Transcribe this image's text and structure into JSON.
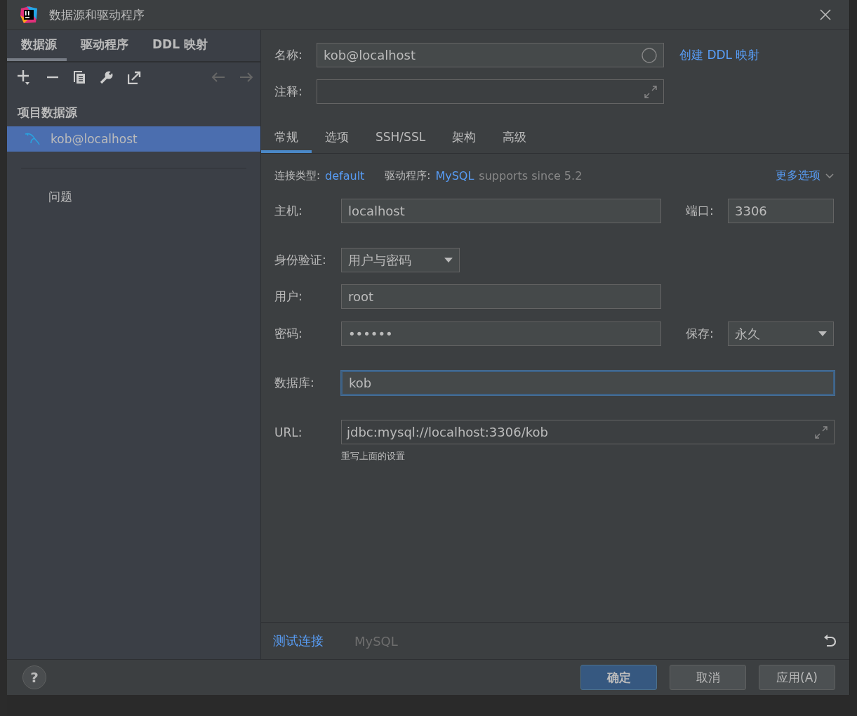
{
  "window": {
    "title": "数据源和驱动程序"
  },
  "left_tabs": [
    {
      "label": "数据源",
      "selected": true
    },
    {
      "label": "驱动程序",
      "selected": false
    },
    {
      "label": "DDL 映射",
      "selected": false
    }
  ],
  "section_title": "项目数据源",
  "datasources": [
    {
      "name": "kob@localhost",
      "selected": true
    }
  ],
  "problems_label": "问题",
  "name_field": {
    "label": "名称:",
    "value": "kob@localhost"
  },
  "create_ddl_link": "创建 DDL 映射",
  "comment_field": {
    "label": "注释:"
  },
  "tabs": [
    {
      "label": "常规",
      "selected": true
    },
    {
      "label": "选项",
      "selected": false
    },
    {
      "label": "SSH/SSL",
      "selected": false
    },
    {
      "label": "架构",
      "selected": false
    },
    {
      "label": "高级",
      "selected": false
    }
  ],
  "connection_type": {
    "label": "连接类型:",
    "value": "default"
  },
  "driver": {
    "label": "驱动程序:",
    "value": "MySQL",
    "note": "supports since 5.2"
  },
  "more_options": "更多选项",
  "host": {
    "label": "主机:",
    "value": "localhost"
  },
  "port": {
    "label": "端口:",
    "value": "3306"
  },
  "auth": {
    "label": "身份验证:",
    "value": "用户与密码"
  },
  "user": {
    "label": "用户:",
    "value": "root"
  },
  "password": {
    "label": "密码:",
    "value": "••••••"
  },
  "save": {
    "label": "保存:",
    "value": "永久"
  },
  "database": {
    "label": "数据库:",
    "value": "kob",
    "focused": true
  },
  "url": {
    "label": "URL:",
    "value": "jdbc:mysql://localhost:3306/kob",
    "hint": "重写上面的设置"
  },
  "footer": {
    "test_connection": "测试连接",
    "driver_name": "MySQL"
  },
  "help_button": "?",
  "buttons": [
    {
      "label": "确定",
      "kind": "primary"
    },
    {
      "label": "取消",
      "kind": "default"
    },
    {
      "label": "应用(A)",
      "kind": "default"
    }
  ]
}
